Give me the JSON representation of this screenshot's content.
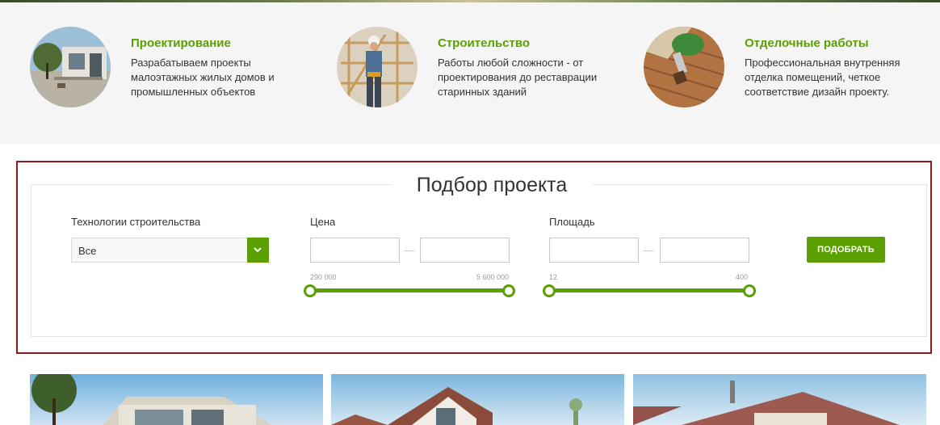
{
  "services": [
    {
      "title": "Проектирование",
      "description": "Разрабатываем проекты малоэтажных жилых домов и промышленных объектов",
      "image": "modern-house-photo"
    },
    {
      "title": "Строительство",
      "description": "Работы любой сложности - от проектирования до реставрации старинных зданий",
      "image": "builder-photo"
    },
    {
      "title": "Отделочные работы",
      "description": "Профессиональная внутренняя отделка помещений, четкое соответствие дизайн проекту.",
      "image": "painting-brush-photo"
    }
  ],
  "picker": {
    "title": "Подбор проекта",
    "technology": {
      "label": "Технологии строительства",
      "selected": "Все"
    },
    "price": {
      "label": "Цена",
      "min_value": "",
      "max_value": "",
      "range_min_label": "290 000",
      "range_max_label": "5 600 000",
      "range_min": 290000,
      "range_max": 5600000
    },
    "area": {
      "label": "Площадь",
      "min_value": "",
      "max_value": "",
      "range_min_label": "12",
      "range_max_label": "400",
      "range_min": 12,
      "range_max": 400
    },
    "submit_label": "ПОДОБРАТЬ"
  },
  "projects": [
    {
      "image": "house-photo-1"
    },
    {
      "image": "house-photo-2"
    },
    {
      "image": "house-photo-3"
    }
  ],
  "colors": {
    "accent": "#5aa000",
    "frame": "#8b1a1a",
    "text": "#333333"
  }
}
